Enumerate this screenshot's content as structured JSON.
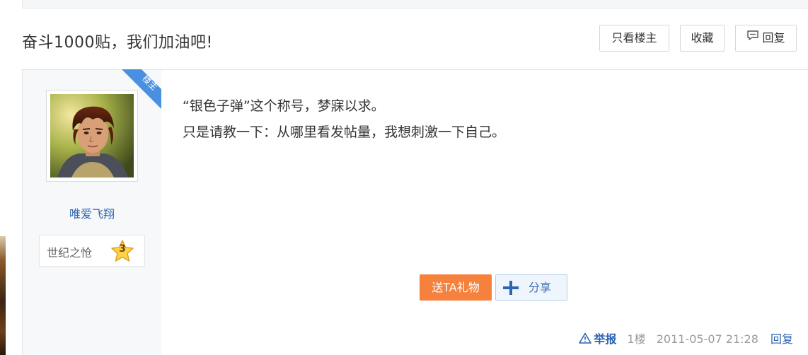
{
  "thread": {
    "title": "奋斗1000贴，我们加油吧!",
    "buttons": {
      "only_owner": "只看楼主",
      "favorite": "收藏",
      "reply": "回复"
    }
  },
  "post": {
    "owner_tag": "楼主",
    "author": {
      "name": "唯爱飞翔",
      "level_title": "世纪之怆",
      "level": "3",
      "avatar_icon": "avatar-portrait"
    },
    "content": [
      "“银色子弹”这个称号，梦寐以求。",
      "只是请教一下：从哪里看发帖量，我想刺激一下自己。"
    ],
    "actions": {
      "gift": "送TA礼物",
      "share": "分享"
    },
    "tail": {
      "report": "举报",
      "floor": "1楼",
      "time": "2011-05-07 21:28",
      "reply": "回复"
    }
  },
  "colors": {
    "link_blue": "#2d64b3",
    "gift_orange": "#f5813d",
    "ribbon_blue": "#4a90e2",
    "sidebar_bg": "#f7f8fa"
  }
}
